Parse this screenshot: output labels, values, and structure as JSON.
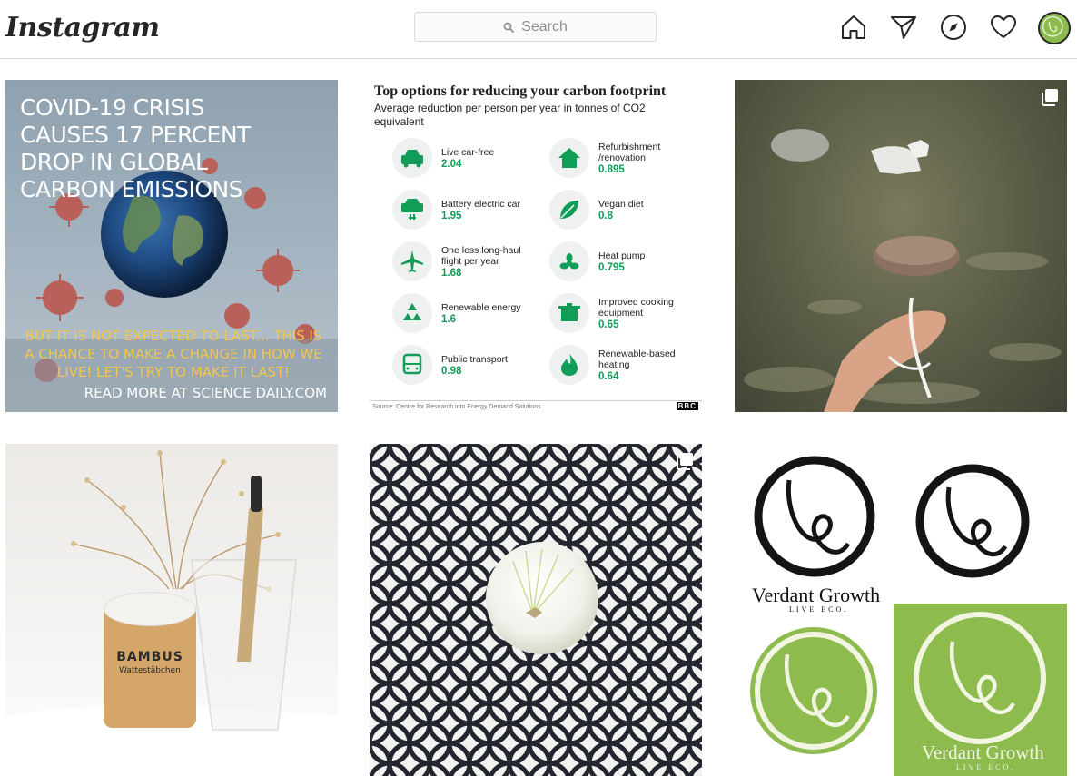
{
  "header": {
    "logo_text": "Instagram",
    "search": {
      "placeholder": "Search",
      "icon": "magnifier-icon"
    },
    "nav_icons": [
      "home-icon",
      "direct-message-icon",
      "explore-icon",
      "activity-heart-icon",
      "profile-avatar"
    ]
  },
  "posts": [
    {
      "headline": "COVID-19 CRISIS CAUSES 17 PERCENT DROP IN GLOBAL CARBON EMISSIONS",
      "subline": "BUT IT IS NOT EXPECTED TO LAST... THIS IS A CHANCE TO MAKE A CHANGE IN HOW WE LIVE! LET'S TRY TO MAKE IT LAST!",
      "footer": "READ MORE AT SCIENCE DAILY.COM"
    },
    {
      "title": "Top options for reducing your carbon footprint",
      "subtitle": "Average reduction per person per year in tonnes of CO2 equivalent",
      "items": [
        {
          "label": "Live car-free",
          "value": "2.04",
          "icon": "car-icon"
        },
        {
          "label": "Battery electric car",
          "value": "1.95",
          "icon": "electric-car-icon"
        },
        {
          "label": "One less long-haul flight per year",
          "value": "1.68",
          "icon": "plane-icon"
        },
        {
          "label": "Renewable energy",
          "value": "1.6",
          "icon": "recycle-icon"
        },
        {
          "label": "Public transport",
          "value": "0.98",
          "icon": "bus-icon"
        },
        {
          "label": "Refurbishment /renovation",
          "value": "0.895",
          "icon": "house-icon"
        },
        {
          "label": "Vegan diet",
          "value": "0.8",
          "icon": "leaf-icon"
        },
        {
          "label": "Heat pump",
          "value": "0.795",
          "icon": "fan-icon"
        },
        {
          "label": "Improved cooking equipment",
          "value": "0.65",
          "icon": "pot-icon"
        },
        {
          "label": "Renewable-based heating",
          "value": "0.64",
          "icon": "flame-icon"
        }
      ],
      "source": "Source: Centre for Research into Energy Demand Solutions",
      "badge": "BBC"
    },
    {
      "multi": true
    },
    {
      "jar_brand": "BAMBUS",
      "jar_sub": "Wattestäbchen"
    },
    {
      "multi": true
    },
    {
      "brand": "Verdant Growth",
      "motto": "LIVE ECO."
    }
  ],
  "colors": {
    "accent_green": "#0f9d58",
    "brand_green": "#8dbb4e",
    "border": "#dbdbdb"
  }
}
